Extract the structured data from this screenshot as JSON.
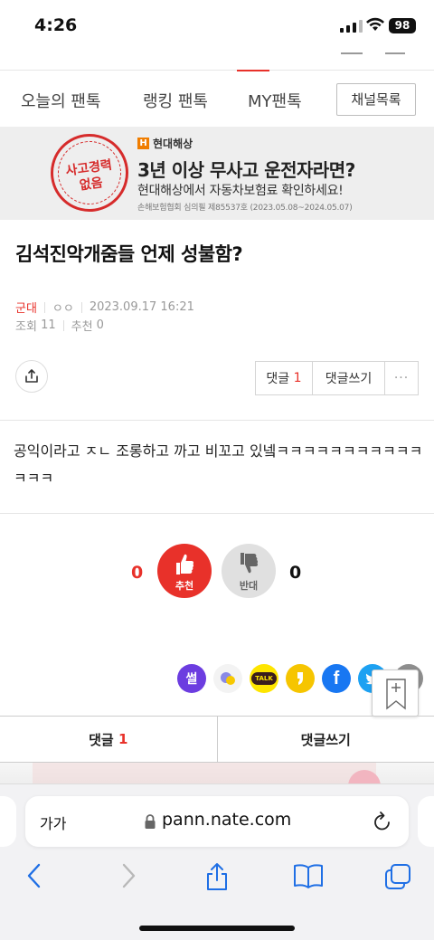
{
  "status_bar": {
    "time": "4:26",
    "battery": "98"
  },
  "nav": {
    "tabs": [
      "오늘의 팬톡",
      "랭킹 팬톡",
      "MY팬톡"
    ],
    "channel_button": "채널목록"
  },
  "ad": {
    "stamp_line1": "사고경력",
    "stamp_line2": "없음",
    "brand": "현대해상",
    "headline": "3년 이상 무사고 운전자라면?",
    "subline": "현대해상에서 자동차보험료 확인하세요!",
    "fineprint": "손해보험협회 심의필 제85537호 (2023.05.08~2024.05.07)"
  },
  "article": {
    "title": "김석진악개줌들 언제 성불함?",
    "category": "군대",
    "author": "ㅇㅇ",
    "date": "2023.09.17 16:21",
    "views_label": "조회",
    "views": "11",
    "likes_label": "추천",
    "likes": "0",
    "body": "공익이라고 ㅈㄴ 조롱하고 까고 비꼬고 있넼ㅋㅋㅋㅋㅋㅋㅋㅋㅋㅋㅋㅋㅋㅋ"
  },
  "actions": {
    "comment_label": "댓글",
    "comment_count": "1",
    "write_comment_label": "댓글쓰기",
    "more": "···"
  },
  "vote": {
    "up_count": "0",
    "up_label": "추천",
    "down_label": "반대",
    "down_count": "0"
  },
  "social": {
    "seol": "썰",
    "talk": "TALK"
  },
  "comment_bar": {
    "comment_label": "댓글",
    "comment_count": "1",
    "write_label": "댓글쓰기"
  },
  "browser": {
    "text_size": "가가",
    "url": "pann.nate.com"
  }
}
